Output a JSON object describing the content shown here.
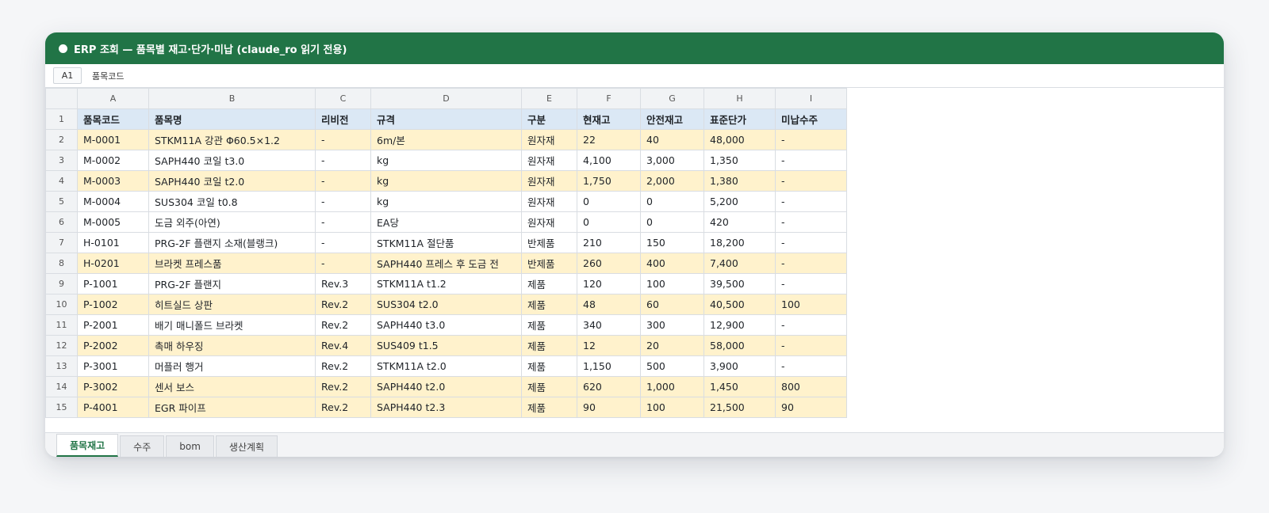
{
  "window": {
    "title": "ERP 조회 — 품목별 재고·단가·미납 (claude_ro 읽기 전용)"
  },
  "formula_bar": {
    "cell_ref": "A1",
    "value": "품목코드"
  },
  "sheet": {
    "columns": [
      "A",
      "B",
      "C",
      "D",
      "E",
      "F",
      "G",
      "H",
      "I"
    ],
    "rows": [
      {
        "num": "1",
        "highlight": "header",
        "cells": [
          "품목코드",
          "품목명",
          "리비전",
          "규격",
          "구분",
          "현재고",
          "안전재고",
          "표준단가",
          "미납수주"
        ]
      },
      {
        "num": "2",
        "highlight": "yellow",
        "cells": [
          "M-0001",
          "STKM11A 강관 Φ60.5×1.2",
          "-",
          "6m/본",
          "원자재",
          "22",
          "40",
          "48,000",
          "-"
        ]
      },
      {
        "num": "3",
        "highlight": "none",
        "cells": [
          "M-0002",
          "SAPH440 코일 t3.0",
          "-",
          "kg",
          "원자재",
          "4,100",
          "3,000",
          "1,350",
          "-"
        ]
      },
      {
        "num": "4",
        "highlight": "yellow",
        "cells": [
          "M-0003",
          "SAPH440 코일 t2.0",
          "-",
          "kg",
          "원자재",
          "1,750",
          "2,000",
          "1,380",
          "-"
        ]
      },
      {
        "num": "5",
        "highlight": "none",
        "cells": [
          "M-0004",
          "SUS304 코일 t0.8",
          "-",
          "kg",
          "원자재",
          "0",
          "0",
          "5,200",
          "-"
        ]
      },
      {
        "num": "6",
        "highlight": "none",
        "cells": [
          "M-0005",
          "도금 외주(아연)",
          "-",
          "EA당",
          "원자재",
          "0",
          "0",
          "420",
          "-"
        ]
      },
      {
        "num": "7",
        "highlight": "none",
        "cells": [
          "H-0101",
          "PRG-2F 플랜지 소재(블랭크)",
          "-",
          "STKM11A 절단품",
          "반제품",
          "210",
          "150",
          "18,200",
          "-"
        ]
      },
      {
        "num": "8",
        "highlight": "yellow",
        "cells": [
          "H-0201",
          "브라켓 프레스품",
          "-",
          "SAPH440 프레스 후 도금 전",
          "반제품",
          "260",
          "400",
          "7,400",
          "-"
        ]
      },
      {
        "num": "9",
        "highlight": "none",
        "cells": [
          "P-1001",
          "PRG-2F 플랜지",
          "Rev.3",
          "STKM11A t1.2",
          "제품",
          "120",
          "100",
          "39,500",
          "-"
        ]
      },
      {
        "num": "10",
        "highlight": "yellow",
        "cells": [
          "P-1002",
          "히트실드 상판",
          "Rev.2",
          "SUS304 t2.0",
          "제품",
          "48",
          "60",
          "40,500",
          "100"
        ]
      },
      {
        "num": "11",
        "highlight": "none",
        "cells": [
          "P-2001",
          "배기 매니폴드 브라켓",
          "Rev.2",
          "SAPH440 t3.0",
          "제품",
          "340",
          "300",
          "12,900",
          "-"
        ]
      },
      {
        "num": "12",
        "highlight": "yellow",
        "cells": [
          "P-2002",
          "촉매 하우징",
          "Rev.4",
          "SUS409 t1.5",
          "제품",
          "12",
          "20",
          "58,000",
          "-"
        ]
      },
      {
        "num": "13",
        "highlight": "none",
        "cells": [
          "P-3001",
          "머플러 행거",
          "Rev.2",
          "STKM11A t2.0",
          "제품",
          "1,150",
          "500",
          "3,900",
          "-"
        ]
      },
      {
        "num": "14",
        "highlight": "yellow",
        "cells": [
          "P-3002",
          "센서 보스",
          "Rev.2",
          "SAPH440 t2.0",
          "제품",
          "620",
          "1,000",
          "1,450",
          "800"
        ]
      },
      {
        "num": "15",
        "highlight": "yellow",
        "cells": [
          "P-4001",
          "EGR 파이프",
          "Rev.2",
          "SAPH440 t2.3",
          "제품",
          "90",
          "100",
          "21,500",
          "90"
        ]
      }
    ]
  },
  "tabs": [
    {
      "label": "품목재고",
      "active": true
    },
    {
      "label": "수주",
      "active": false
    },
    {
      "label": "bom",
      "active": false
    },
    {
      "label": "생산계획",
      "active": false
    }
  ],
  "colors": {
    "brand_green": "#217446",
    "header_row_blue": "#dbe8f5",
    "highlight_yellow": "#fff2cc"
  }
}
